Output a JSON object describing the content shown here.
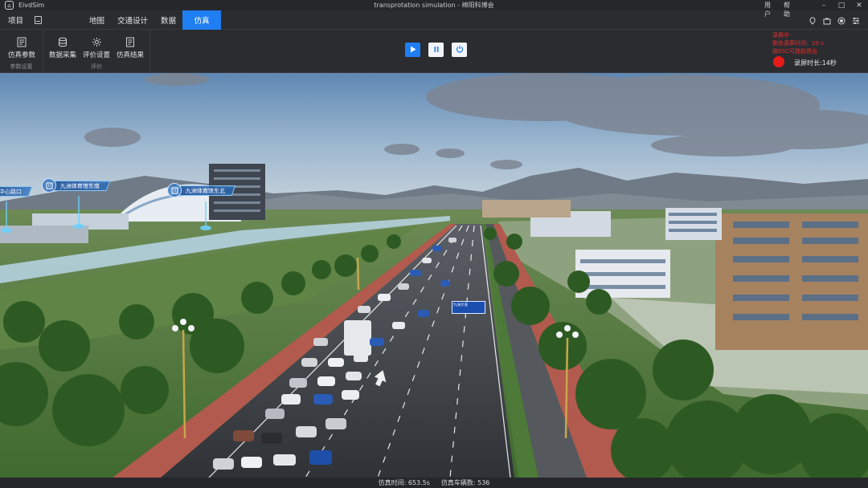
{
  "app": {
    "name": "EivdSim",
    "window_title": "transprotation simulation - 绵阳科博会"
  },
  "window_controls": {
    "minimize": "–",
    "maximize": "□",
    "close": "✕"
  },
  "menu": {
    "project": "项目",
    "tabs": [
      "地图",
      "交通设计",
      "数据",
      "仿真"
    ],
    "active_tab": "仿真",
    "user": "用户",
    "help": "帮助"
  },
  "ribbon": {
    "groups": [
      {
        "label": "参数设置",
        "buttons": [
          {
            "label": "仿真参数",
            "icon": "document-icon"
          }
        ]
      },
      {
        "label": "评价",
        "buttons": [
          {
            "label": "数据采集",
            "icon": "database-icon"
          },
          {
            "label": "评价设置",
            "icon": "settings-icon"
          },
          {
            "label": "仿真结果",
            "icon": "report-icon"
          }
        ]
      }
    ]
  },
  "playback": {
    "play": "play-icon",
    "pause": "pause-icon",
    "stop": "power-icon"
  },
  "recording": {
    "lines": [
      "录屏中",
      "剩余录屏时间：20 s",
      "按ESC可提前退出"
    ],
    "duration_label": "录屏时长:14秒"
  },
  "scene": {
    "poi_labels": [
      "中心路口",
      "九洲体育馆东南",
      "九洲体育馆东北"
    ],
    "sign_text": "九洲大道"
  },
  "status": {
    "sim_time": "仿真时间: 653.5s",
    "vehicle_count": "仿真车辆数: 536"
  },
  "colors": {
    "accent": "#1f7ef2",
    "record": "#e81b1b",
    "sky": "#86a9c9"
  }
}
